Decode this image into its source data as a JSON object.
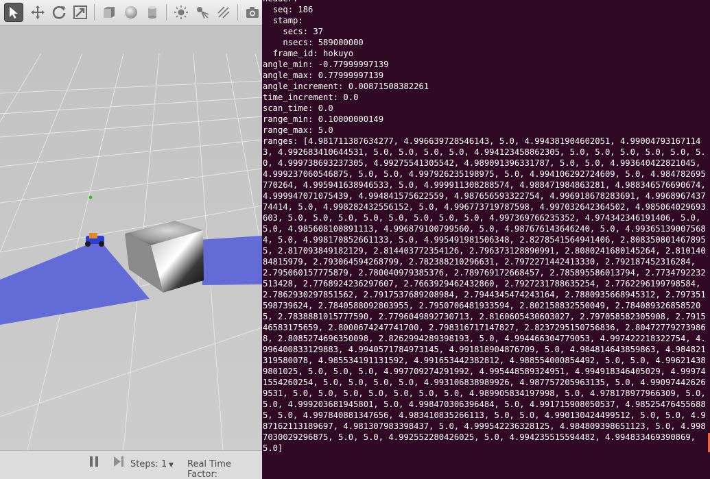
{
  "gazebo": {
    "toolbar": {
      "tools": [
        {
          "name": "select-mode-icon",
          "active": true
        },
        {
          "name": "translate-mode-icon",
          "active": false
        },
        {
          "name": "rotate-mode-icon",
          "active": false
        },
        {
          "name": "scale-mode-icon",
          "active": false
        },
        {
          "name": "box-shape-icon",
          "active": false
        },
        {
          "name": "sphere-shape-icon",
          "active": false
        },
        {
          "name": "cylinder-shape-icon",
          "active": false
        },
        {
          "name": "point-light-icon",
          "active": false
        },
        {
          "name": "spot-light-icon",
          "active": false
        },
        {
          "name": "directional-light-icon",
          "active": false
        },
        {
          "name": "screenshot-icon",
          "active": false
        }
      ]
    },
    "bottom": {
      "steps_label": "Steps:",
      "steps_value": "1",
      "rtf_label": "Real Time Factor:"
    },
    "colors": {
      "ground": "#c9c9c9",
      "laser": "#5a63d8",
      "robot_body": "#2b3fd0",
      "robot_top": "#e08a2a"
    }
  },
  "terminal": {
    "text": "header:\n  seq: 186\n  stamp:\n    secs: 37\n    nsecs: 589000000\n  frame_id: hokuyo\nangle_min: -0.77999997139\nangle_max: 0.77999997139\nangle_increment: 0.00871508382261\ntime_increment: 0.0\nscan_time: 0.0\nrange_min: 0.10000000149\nrange_max: 5.0\nranges: [4.981711387634277, 4.996639728546143, 5.0, 4.994381904602051, 4.990047931671143, 4.992683410644531, 5.0, 5.0, 5.0, 5.0, 4.994123458862305, 5.0, 5.0, 5.0, 5.0, 5.0, 5.0, 4.999738693237305, 4.99275541305542, 4.989091396331787, 5.0, 5.0, 4.993640422821045, 4.999237060546875, 5.0, 5.0, 4.997926235198975, 5.0, 4.994106292724609, 5.0, 4.984782695770264, 4.995941638946533, 5.0, 4.999911308288574, 4.988471984863281, 4.988346576690674, 4.999947071075439, 4.994841575622559, 4.987656593322754, 4.996918678283691, 4.996896743774414, 5.0, 4.998282432556152, 5.0, 4.996773719787598, 4.997032642364502, 4.985064029693603, 5.0, 5.0, 5.0, 5.0, 5.0, 5.0, 5.0, 5.0, 4.997369766235352, 4.974342346191406, 5.0, 5.0, 4.985608100891113, 4.996879100799560, 5.0, 4.987676143646240, 5.0, 4.993651390075684, 5.0, 4.998170852661133, 5.0, 4.995491981506348, 2.8278541564941406, 2.8083508014678955, 2.817093849182129, 2.814403772354126, 2.796373128890991, 2.8080241680145264, 2.81014084815979, 2.793064594268799, 2.782388210296631, 2.7972271442413330, 2.792187452316284, 2.795060157775879, 2.780040979385376, 2.789769172668457, 2.785895586013794, 2.7734792232513428, 2.7768924236297607, 2.7663929462432860, 2.7927231788635254, 2.7762296199798584, 2.7862930297851562, 2.7917537689208984, 2.7944345474243164, 2.7880935668945312, 2.797351598739624, 2.7840588092803955, 2.7950706481933594, 2.802158832550049, 2.7840893268585205, 2.7838881015777590, 2.7796049892730713, 2.8160605430603027, 2.797058582305908, 2.791546583175659, 2.8000674247741700, 2.798316717147827, 2.8237295150756836, 2.804727792739868, 2.8085274696350098, 2.8262994289398193, 5.0, 4.994466304779053, 4.997422218322754, 4.996400833129883, 4.9940571784973145, 4.991818904876709, 5.0, 4.984814643859863, 4.984821319580078, 4.985534191131592, 4.991653442382812, 4.988554000854492, 5.0, 5.0, 4.996214389801025, 5.0, 5.0, 5.0, 4.997709274291992, 4.995448589324951, 4.994918346405029, 4.999741554260254, 5.0, 5.0, 5.0, 5.0, 4.993106838989926, 4.987757205963135, 5.0, 4.990974426269531, 5.0, 5.0, 5.0, 5.0, 5.0, 5.0, 5.0, 4.989905834197998, 5.0, 4.978178977966309, 5.0, 5.0, 4.999203681945801, 5.0, 4.998470306396484, 5.0, 4.991715908050537, 4.985254764556885, 5.0, 4.997840881347656, 4.983410835266113, 5.0, 5.0, 4.990130424499512, 5.0, 5.0, 4.987162113189697, 4.981307983398437, 5.0, 4.999542236328125, 4.984809398651123, 5.0, 4.9987030029296875, 5.0, 5.0, 4.992552280426025, 5.0, 4.994235515594482, 4.994833469390869, 5.0]"
  }
}
